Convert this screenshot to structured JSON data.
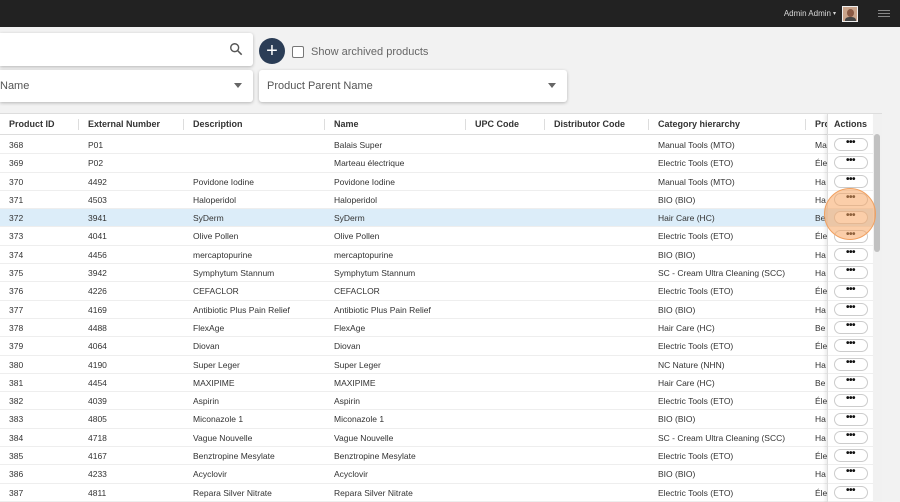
{
  "topbar": {
    "user_name": "Admin Admin",
    "caret": "▾"
  },
  "search": {
    "value": "",
    "placeholder": ""
  },
  "add_button": {
    "label": "+"
  },
  "archived": {
    "label": "Show archived products",
    "checked": false
  },
  "filters": {
    "name_label": "Name",
    "parent_label": "Product Parent Name"
  },
  "columns": [
    "Product ID",
    "External Number",
    "Description",
    "Name",
    "UPC Code",
    "Distributor Code",
    "Category hierarchy",
    "Pro"
  ],
  "actions_header": "Actions",
  "action_button_label": "•••",
  "selected_row": 4,
  "rows": [
    [
      "368",
      "P01",
      "",
      "Balais Super",
      "",
      "",
      "Manual Tools (MTO)",
      "Ma"
    ],
    [
      "369",
      "P02",
      "",
      "Marteau électrique",
      "",
      "",
      "Electric Tools (ETO)",
      "Éle"
    ],
    [
      "370",
      "4492",
      "Povidone Iodine",
      "Povidone Iodine",
      "",
      "",
      "Manual Tools (MTO)",
      "Ha"
    ],
    [
      "371",
      "4503",
      "Haloperidol",
      "Haloperidol",
      "",
      "",
      "BIO (BIO)",
      "Ha"
    ],
    [
      "372",
      "3941",
      "SyDerm",
      "SyDerm",
      "",
      "",
      "Hair Care (HC)",
      "Be"
    ],
    [
      "373",
      "4041",
      "Olive Pollen",
      "Olive Pollen",
      "",
      "",
      "Electric Tools (ETO)",
      "Éle"
    ],
    [
      "374",
      "4456",
      "mercaptopurine",
      "mercaptopurine",
      "",
      "",
      "BIO (BIO)",
      "Ha"
    ],
    [
      "375",
      "3942",
      "Symphytum Stannum",
      "Symphytum Stannum",
      "",
      "",
      "SC - Cream Ultra Cleaning (SCC)",
      "Ha"
    ],
    [
      "376",
      "4226",
      "CEFACLOR",
      "CEFACLOR",
      "",
      "",
      "Electric Tools (ETO)",
      "Éle"
    ],
    [
      "377",
      "4169",
      "Antibiotic Plus Pain Relief",
      "Antibiotic Plus Pain Relief",
      "",
      "",
      "BIO (BIO)",
      "Ha"
    ],
    [
      "378",
      "4488",
      "FlexAge",
      "FlexAge",
      "",
      "",
      "Hair Care (HC)",
      "Be"
    ],
    [
      "379",
      "4064",
      "Diovan",
      "Diovan",
      "",
      "",
      "Electric Tools (ETO)",
      "Éle"
    ],
    [
      "380",
      "4190",
      "Super Leger",
      "Super Leger",
      "",
      "",
      "NC Nature (NHN)",
      "Ha"
    ],
    [
      "381",
      "4454",
      "MAXIPIME",
      "MAXIPIME",
      "",
      "",
      "Hair Care (HC)",
      "Be"
    ],
    [
      "382",
      "4039",
      "Aspirin",
      "Aspirin",
      "",
      "",
      "Electric Tools (ETO)",
      "Éle"
    ],
    [
      "383",
      "4805",
      "Miconazole 1",
      "Miconazole 1",
      "",
      "",
      "BIO (BIO)",
      "Ha"
    ],
    [
      "384",
      "4718",
      "Vague Nouvelle",
      "Vague Nouvelle",
      "",
      "",
      "SC - Cream Ultra Cleaning (SCC)",
      "Ha"
    ],
    [
      "385",
      "4167",
      "Benztropine Mesylate",
      "Benztropine Mesylate",
      "",
      "",
      "Electric Tools (ETO)",
      "Éle"
    ],
    [
      "386",
      "4233",
      "Acyclovir",
      "Acyclovir",
      "",
      "",
      "BIO (BIO)",
      "Ha"
    ],
    [
      "387",
      "4811",
      "Repara Silver Nitrate",
      "Repara Silver Nitrate",
      "",
      "",
      "Electric Tools (ETO)",
      "Éle"
    ]
  ]
}
